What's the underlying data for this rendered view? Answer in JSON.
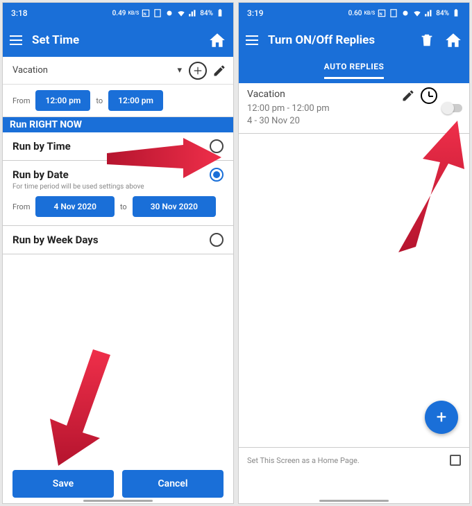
{
  "screen1": {
    "status": {
      "time": "3:18",
      "net": "0.49",
      "net_unit": "KB/S",
      "battery": "84%"
    },
    "appbar": {
      "title": "Set Time"
    },
    "dropdown": {
      "value": "Vacation"
    },
    "time": {
      "from_label": "From",
      "from_value": "12:00 pm",
      "to_label": "to",
      "to_value": "12:00 pm"
    },
    "run_now": "Run RIGHT NOW",
    "options": {
      "by_time": "Run by Time",
      "by_date": "Run by Date",
      "by_date_hint": "For time period will be used settings above",
      "by_week": "Run by Week Days"
    },
    "dates": {
      "from_label": "From",
      "from_value": "4 Nov 2020",
      "to_label": "to",
      "to_value": "30 Nov 2020"
    },
    "buttons": {
      "save": "Save",
      "cancel": "Cancel"
    }
  },
  "screen2": {
    "status": {
      "time": "3:19",
      "net": "0.60",
      "net_unit": "KB/S",
      "battery": "84%"
    },
    "appbar": {
      "title": "Turn ON/Off Replies"
    },
    "tab": "AUTO REPLIES",
    "card": {
      "title": "Vacation",
      "line1": "12:00 pm - 12:00 pm",
      "line2": "4 - 30 Nov 20"
    },
    "home_setting": "Set This Screen as a Home Page.",
    "fab": "+"
  }
}
